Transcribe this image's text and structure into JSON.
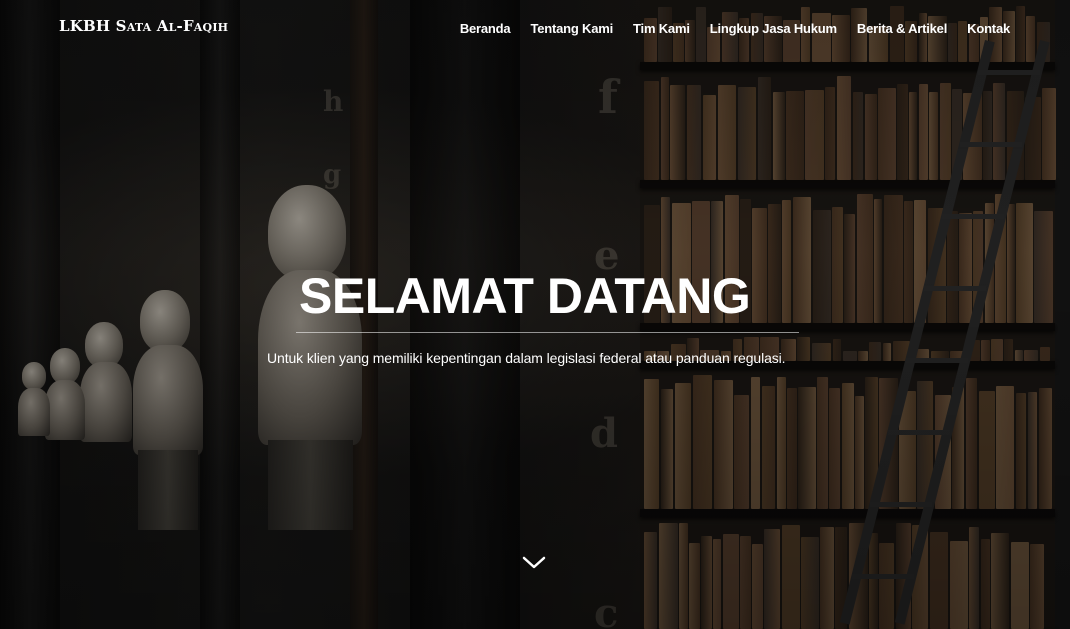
{
  "navbar": {
    "brand": "LKBH Sata Al-Faqih",
    "links": [
      {
        "label": "Beranda"
      },
      {
        "label": "Tentang Kami"
      },
      {
        "label": "Tim Kami"
      },
      {
        "label": "Lingkup Jasa Hukum"
      },
      {
        "label": "Berita & Artikel"
      },
      {
        "label": "Kontak"
      }
    ]
  },
  "hero": {
    "title": "SELAMAT DATANG",
    "subtitle": "Untuk klien yang memiliki kepentingan dalam legislasi federal atau panduan regulasi.",
    "scroll_icon": "chevron-down-icon"
  },
  "colors": {
    "text": "#ffffff",
    "overlay": "#000000"
  }
}
